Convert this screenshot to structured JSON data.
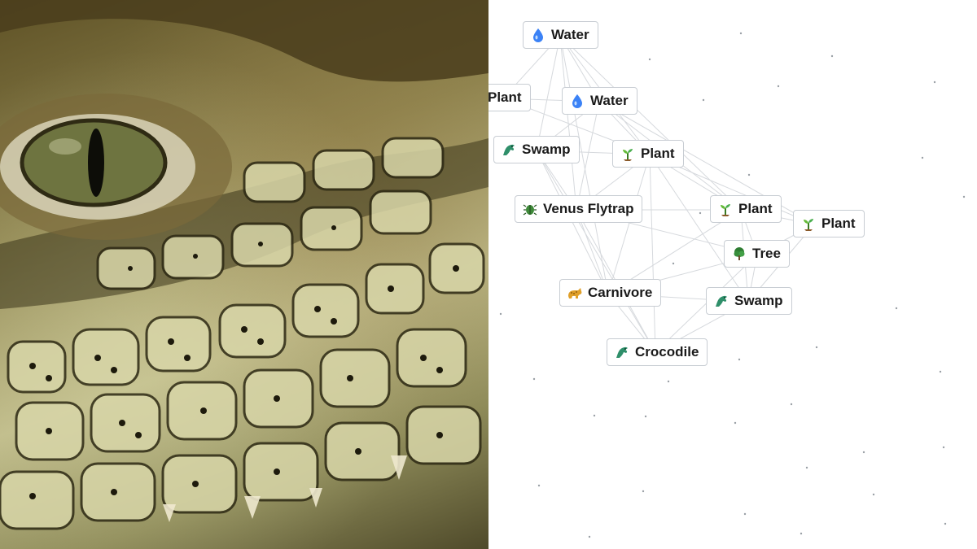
{
  "photo": {
    "alt_subject": "crocodile-eye"
  },
  "canvas": {
    "items": [
      {
        "id": "water-1",
        "label": "Water",
        "icon": "water-drop-icon",
        "color": "#3b82f6"
      },
      {
        "id": "plant-partial",
        "label": "Plant",
        "icon": "",
        "color": ""
      },
      {
        "id": "water-2",
        "label": "Water",
        "icon": "water-drop-icon",
        "color": "#3b82f6"
      },
      {
        "id": "swamp-1",
        "label": "Swamp",
        "icon": "dragon-icon",
        "color": "#2f8f6a"
      },
      {
        "id": "plant-1",
        "label": "Plant",
        "icon": "seedling-icon",
        "color": "#4caf50"
      },
      {
        "id": "venus-flytrap",
        "label": "Venus Flytrap",
        "icon": "bug-icon",
        "color": "#3f8a3a"
      },
      {
        "id": "plant-2",
        "label": "Plant",
        "icon": "seedling-icon",
        "color": "#4caf50"
      },
      {
        "id": "plant-3",
        "label": "Plant",
        "icon": "seedling-icon",
        "color": "#4caf50"
      },
      {
        "id": "tree",
        "label": "Tree",
        "icon": "tree-icon",
        "color": "#2e7d32"
      },
      {
        "id": "carnivore",
        "label": "Carnivore",
        "icon": "leopard-icon",
        "color": "#e0a02a"
      },
      {
        "id": "swamp-2",
        "label": "Swamp",
        "icon": "dragon-icon",
        "color": "#2f8f6a"
      },
      {
        "id": "crocodile",
        "label": "Crocodile",
        "icon": "dragon-icon",
        "color": "#2f8f6a"
      }
    ],
    "colors": {
      "link": "#cfd3d8",
      "border": "#c8cdd3"
    }
  }
}
